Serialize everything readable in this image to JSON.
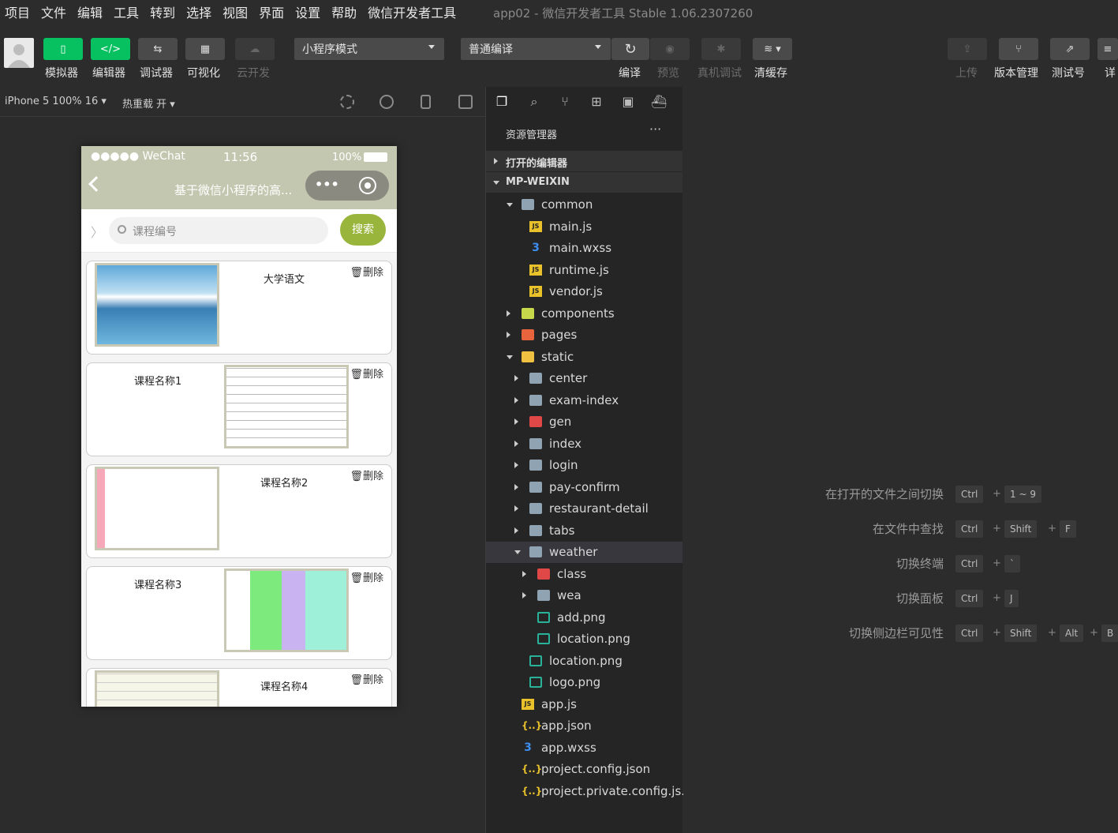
{
  "menu": [
    "项目",
    "文件",
    "编辑",
    "工具",
    "转到",
    "选择",
    "视图",
    "界面",
    "设置",
    "帮助",
    "微信开发者工具"
  ],
  "window_title": "app02 - 微信开发者工具 Stable 1.06.2307260",
  "toolbar": {
    "simulator": "模拟器",
    "editor": "编辑器",
    "debugger": "调试器",
    "visual": "可视化",
    "cloud": "云开发",
    "mode": "小程序模式",
    "compile_mode": "普通编译",
    "compile": "编译",
    "preview": "预览",
    "remote_debug": "真机调试",
    "clear_cache": "清缓存",
    "upload": "上传",
    "version": "版本管理",
    "test": "测试号",
    "detail": "详"
  },
  "sim_header": {
    "device": "iPhone 5 100% 16 ▾",
    "hot_reload": "热重载 开 ▾"
  },
  "phone": {
    "carrier": "●●●●● WeChat",
    "time": "11:56",
    "battery": "100%",
    "title": "基于微信小程序的高...",
    "search_placeholder": "课程编号",
    "search_button": "搜索",
    "delete_label": "删除",
    "courses": [
      "大学语文",
      "课程名称1",
      "课程名称2",
      "课程名称3",
      "课程名称4"
    ]
  },
  "explorer": {
    "title": "资源管理器",
    "more": "···",
    "open_editors": "打开的编辑器",
    "project": "MP-WEIXIN",
    "items": [
      {
        "label": "common",
        "type": "folder-open",
        "depth": 1
      },
      {
        "label": "main.js",
        "type": "js",
        "depth": 2
      },
      {
        "label": "main.wxss",
        "type": "css",
        "depth": 2
      },
      {
        "label": "runtime.js",
        "type": "js",
        "depth": 2
      },
      {
        "label": "vendor.js",
        "type": "js",
        "depth": 2
      },
      {
        "label": "components",
        "type": "folder",
        "depth": 1
      },
      {
        "label": "pages",
        "type": "folder",
        "depth": 1
      },
      {
        "label": "static",
        "type": "folder-open",
        "depth": 1
      },
      {
        "label": "center",
        "type": "folder",
        "depth": 2
      },
      {
        "label": "exam-index",
        "type": "folder",
        "depth": 2
      },
      {
        "label": "gen",
        "type": "folder",
        "depth": 2
      },
      {
        "label": "index",
        "type": "folder",
        "depth": 2
      },
      {
        "label": "login",
        "type": "folder",
        "depth": 2
      },
      {
        "label": "pay-confirm",
        "type": "folder",
        "depth": 2
      },
      {
        "label": "restaurant-detail",
        "type": "folder",
        "depth": 2
      },
      {
        "label": "tabs",
        "type": "folder",
        "depth": 2
      },
      {
        "label": "weather",
        "type": "folder-open",
        "depth": 2
      },
      {
        "label": "class",
        "type": "folder",
        "depth": 3
      },
      {
        "label": "wea",
        "type": "folder",
        "depth": 3
      },
      {
        "label": "add.png",
        "type": "png",
        "depth": 3
      },
      {
        "label": "location.png",
        "type": "png",
        "depth": 3
      },
      {
        "label": "location.png",
        "type": "png",
        "depth": 2
      },
      {
        "label": "logo.png",
        "type": "png",
        "depth": 2
      },
      {
        "label": "app.js",
        "type": "js",
        "depth": 1
      },
      {
        "label": "app.json",
        "type": "json",
        "depth": 1
      },
      {
        "label": "app.wxss",
        "type": "css",
        "depth": 1
      },
      {
        "label": "project.config.json",
        "type": "json",
        "depth": 1
      },
      {
        "label": "project.private.config.js...",
        "type": "json",
        "depth": 1
      }
    ]
  },
  "shortcuts": [
    {
      "label": "在打开的文件之间切换",
      "keys": [
        "Ctrl",
        "1 ~ 9"
      ]
    },
    {
      "label": "在文件中查找",
      "keys": [
        "Ctrl",
        "Shift",
        "F"
      ]
    },
    {
      "label": "切换终端",
      "keys": [
        "Ctrl",
        "`"
      ]
    },
    {
      "label": "切换面板",
      "keys": [
        "Ctrl",
        "J"
      ]
    },
    {
      "label": "切换侧边栏可见性",
      "keys": [
        "Ctrl",
        "Shift",
        "Alt",
        "B"
      ]
    }
  ],
  "colors": {
    "accent_green": "#07c160",
    "search_button": "#9ab53c",
    "nav_bar": "#c4c7b0"
  }
}
